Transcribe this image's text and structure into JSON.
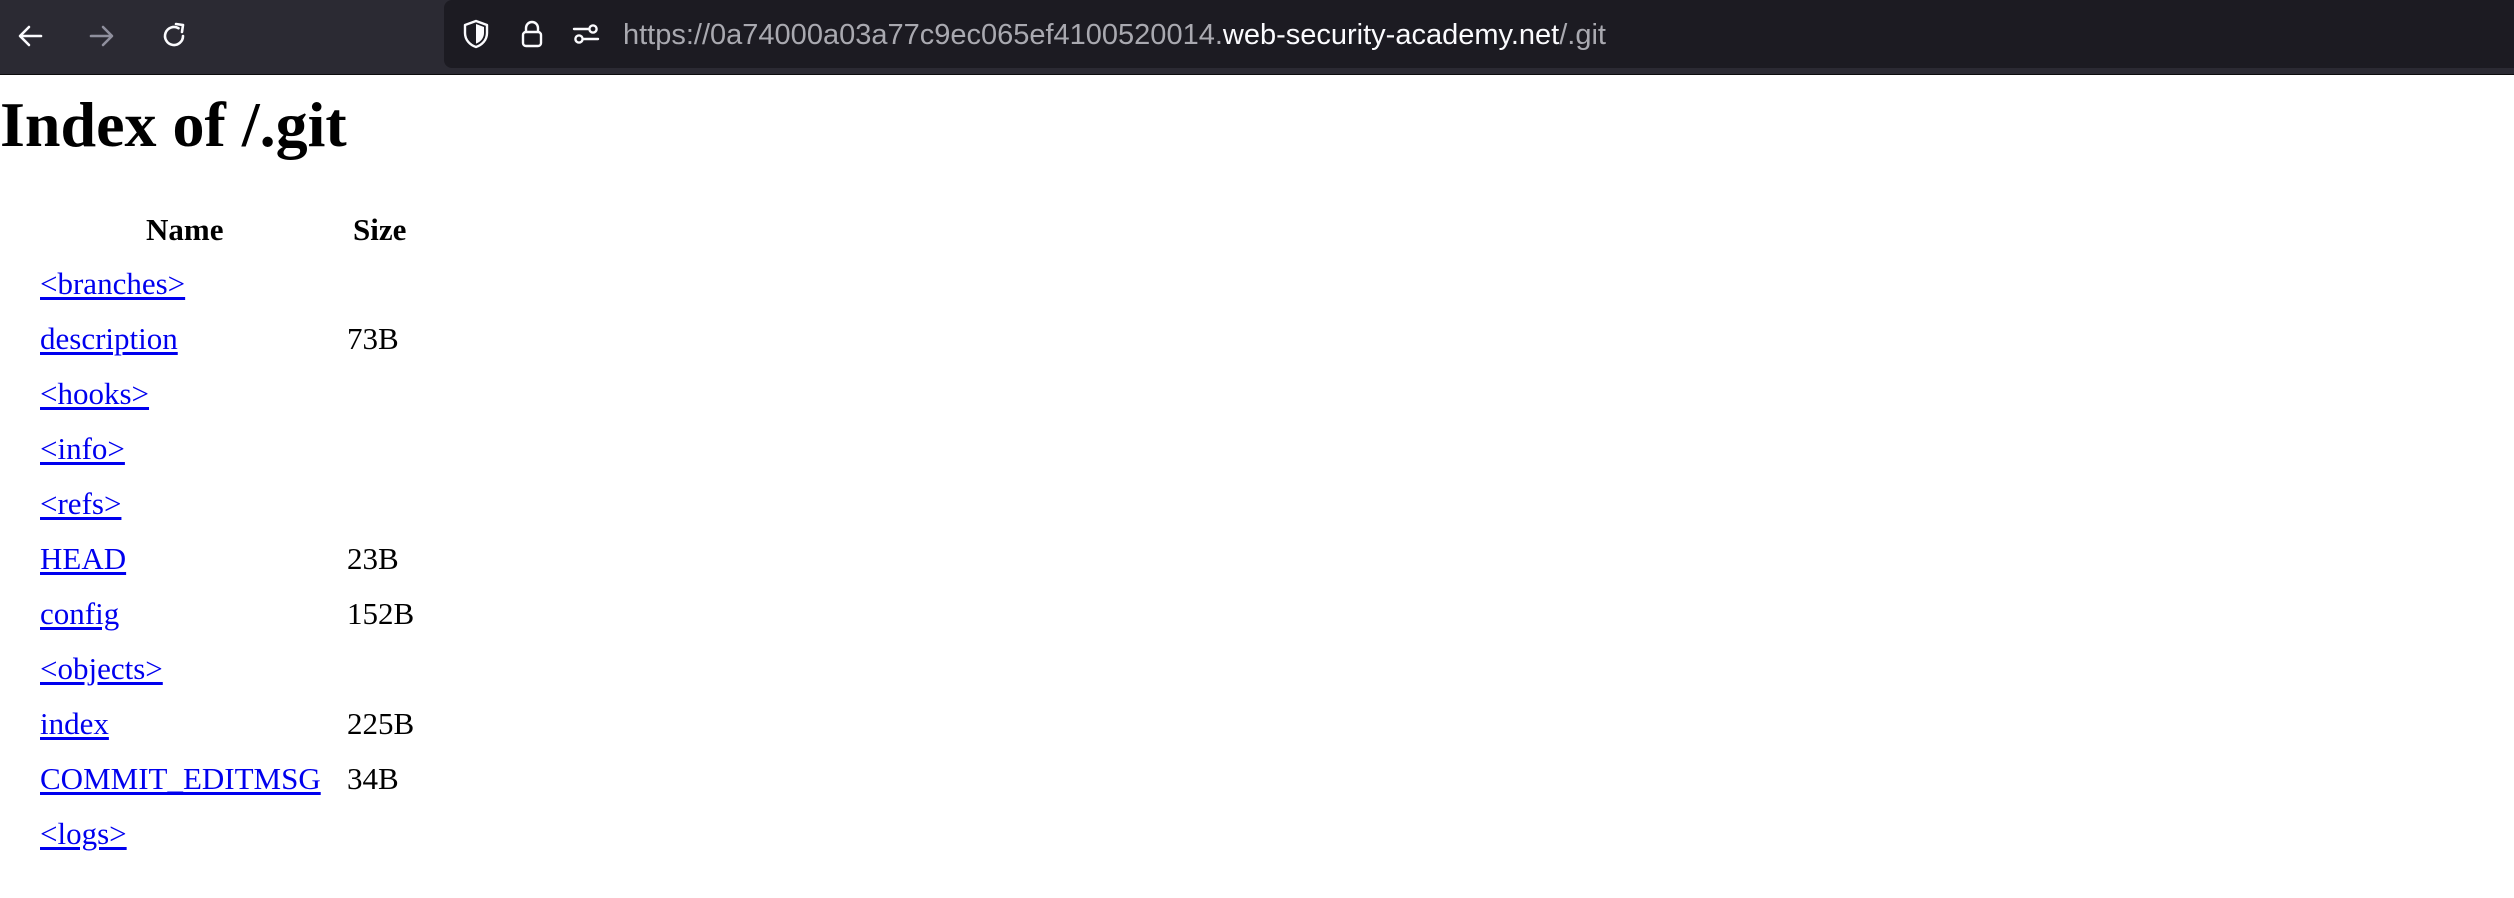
{
  "browser": {
    "url_prefix": "https://0a74000a03a77c9ec065ef4100520014.",
    "url_host": "web-security-academy.net",
    "url_path": "/.git",
    "colors": {
      "toolbar_bg": "#2b2a33",
      "urlbar_bg": "#1c1b22",
      "link": "#0000ee"
    },
    "icons": [
      "back-arrow-icon",
      "forward-arrow-icon",
      "reload-icon",
      "shield-icon",
      "lock-icon",
      "permissions-icon"
    ]
  },
  "page": {
    "title": "Index of /.git",
    "headers": {
      "name": "Name",
      "size": "Size"
    },
    "entries": [
      {
        "name": "<branches>",
        "size": ""
      },
      {
        "name": "description",
        "size": "73B"
      },
      {
        "name": "<hooks>",
        "size": ""
      },
      {
        "name": "<info>",
        "size": ""
      },
      {
        "name": "<refs>",
        "size": ""
      },
      {
        "name": "HEAD",
        "size": "23B"
      },
      {
        "name": "config",
        "size": "152B"
      },
      {
        "name": "<objects>",
        "size": ""
      },
      {
        "name": "index",
        "size": "225B"
      },
      {
        "name": "COMMIT_EDITMSG",
        "size": "34B"
      },
      {
        "name": "<logs>",
        "size": ""
      }
    ]
  }
}
